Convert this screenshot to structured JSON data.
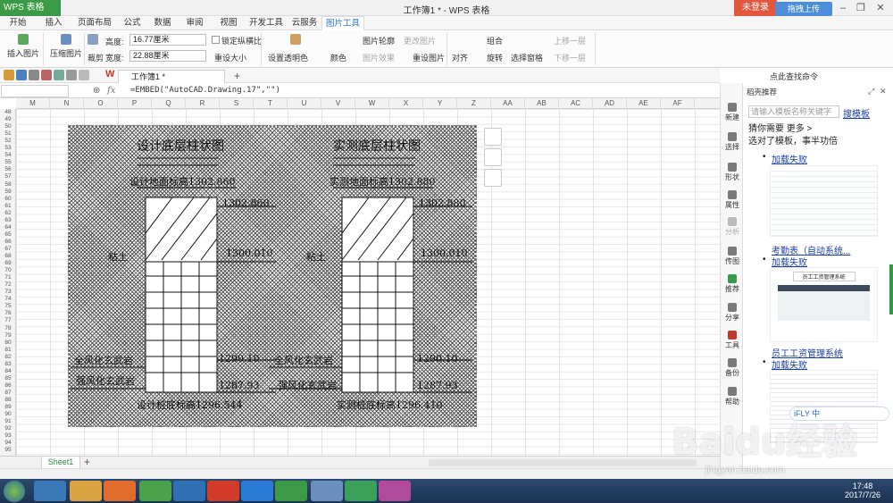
{
  "titlebar": {
    "app_button": "WPS 表格",
    "doc_title": "工作簿1 * - WPS 表格",
    "login": "未登录"
  },
  "menu": {
    "tabs": [
      "开始",
      "插入",
      "页面布局",
      "公式",
      "数据",
      "审阅",
      "视图",
      "开发工具",
      "云服务",
      "图片工具"
    ],
    "active_tab": "图片工具"
  },
  "ribbon": {
    "insert_picture": "插入图片",
    "compress_picture": "压缩图片",
    "crop": "裁剪",
    "rotate": "旋转",
    "height_label": "高度:",
    "height_value": "16.77厘米",
    "width_label": "宽度:",
    "width_value": "22.88厘米",
    "lock_ratio": "锁定纵横比",
    "reset_size": "重设大小",
    "set_transparent": "设置透明色",
    "color": "颜色",
    "picture_outline": "图片轮廓",
    "picture_effect": "图片效果",
    "change_picture": "更改图片",
    "reset_picture": "重设图片",
    "align": "对齐",
    "group": "组合",
    "rotate2": "旋转",
    "selection_pane": "选择窗格",
    "bring_forward": "上移一层",
    "send_backward": "下移一层"
  },
  "upload_button": "拖拽上传",
  "quickbar": {
    "workbook_tab": "工作簿1 *",
    "find_command": "点此查找命令"
  },
  "formula_bar": {
    "fx": "fx",
    "formula": "=EMBED(\"AutoCAD.Drawing.17\",\"\")"
  },
  "columns": [
    "M",
    "N",
    "O",
    "P",
    "Q",
    "R",
    "S",
    "T",
    "U",
    "V",
    "W",
    "X",
    "Y",
    "Z",
    "AA",
    "AB",
    "AC",
    "AD",
    "AE",
    "AF"
  ],
  "rows": [
    "48",
    "49",
    "50",
    "51",
    "52",
    "53",
    "54",
    "55",
    "56",
    "57",
    "58",
    "59",
    "60",
    "61",
    "62",
    "63",
    "64",
    "65",
    "66",
    "67",
    "68",
    "69",
    "70",
    "71",
    "72",
    "73",
    "74",
    "75",
    "76",
    "77",
    "78",
    "79",
    "80",
    "81",
    "82",
    "83",
    "84",
    "85",
    "86",
    "87",
    "88",
    "89",
    "90",
    "91",
    "92",
    "93",
    "94",
    "95"
  ],
  "drawing": {
    "left_title": "设计底层柱状图",
    "right_title": "实测底层柱状图",
    "left_ground": "设计地面标高1302.860",
    "right_ground": "实测地面标高1302.880",
    "left_top_val": "1302.860",
    "right_top_val": "1302.880",
    "left_clay": "粘土",
    "right_clay": "粘土",
    "left_mid_val": "1300.010",
    "right_mid_val": "1300.010",
    "left_full_weather": "全风化玄武岩",
    "right_full_weather": "全风化玄武岩",
    "left_v1": "1290.10",
    "right_v1": "1290.10",
    "left_strong_weather": "强风化玄武岩",
    "right_strong_weather": "强风化玄武岩",
    "left_v2": "1287.93",
    "right_v2": "1287.93",
    "left_bottom": "设计桩底标高1296.544",
    "right_bottom": "实测桩底标高1296.410"
  },
  "sheet_tab": "Sheet1",
  "sidebar": {
    "items": [
      "新建",
      "选择",
      "形状",
      "属性",
      "分析",
      "传图",
      "推荐",
      "分享",
      "工具",
      "备份",
      "帮助"
    ]
  },
  "panel": {
    "header": "稻壳推荐",
    "search_placeholder": "请输入模板名称关键字",
    "search_link": "搜模板",
    "line1": "猜你需要 更多 >",
    "line2": "选对了模板，事半功倍",
    "load_fail": "加载失败",
    "attendance": "考勤表（自动系统...",
    "employee": "员工工资管理系统",
    "thumb_title": "员工工资管理系统"
  },
  "ime": "iFLY 中",
  "clock": {
    "time": "17:48",
    "date": "2017/7/26"
  },
  "watermark": "Baidu经验",
  "watermark_url": "jingyan.baidu.com"
}
